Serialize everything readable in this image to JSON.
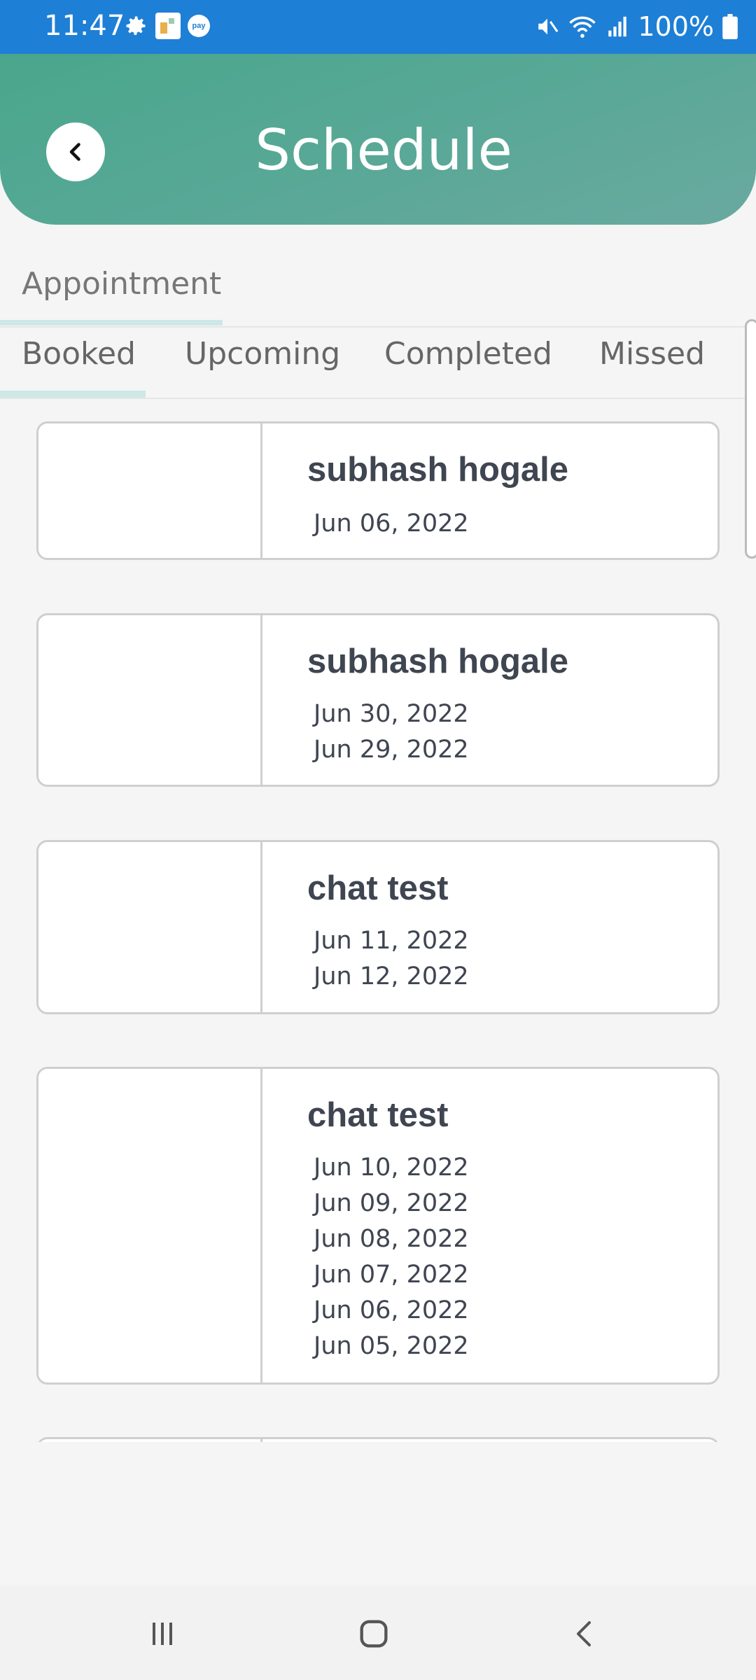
{
  "status_bar": {
    "time": "11:47",
    "battery": "100%",
    "icons": [
      "gear-icon",
      "app-icon",
      "paytm-icon",
      "mute-icon",
      "wifi-icon",
      "signal-icon",
      "battery-icon"
    ]
  },
  "header": {
    "title": "Schedule",
    "back_icon": "chevron-left-icon",
    "gradient": [
      "#4aa68c",
      "#6aa9a0"
    ]
  },
  "section": {
    "label": "Appointment"
  },
  "tabs": [
    {
      "label": "Booked",
      "active": true
    },
    {
      "label": "Upcoming",
      "active": false
    },
    {
      "label": "Completed",
      "active": false
    },
    {
      "label": "Missed",
      "active": false
    }
  ],
  "appointments": [
    {
      "name": "subhash hogale",
      "dates": [
        "Jun 06, 2022"
      ]
    },
    {
      "name": "subhash hogale",
      "dates": [
        "Jun 30, 2022",
        "Jun 29, 2022"
      ]
    },
    {
      "name": "chat test",
      "dates": [
        "Jun 11, 2022",
        "Jun 12, 2022"
      ]
    },
    {
      "name": "chat test",
      "dates": [
        "Jun 10, 2022",
        "Jun 09, 2022",
        "Jun 08, 2022",
        "Jun 07, 2022",
        "Jun 06, 2022",
        "Jun 05, 2022"
      ]
    }
  ],
  "nav_bar": {
    "buttons": [
      "recents-icon",
      "home-icon",
      "back-icon"
    ]
  },
  "colors": {
    "status_bar": "#1e7fd6",
    "text_dark": "#3f4551",
    "tab_indicator": "#cde8e6"
  }
}
